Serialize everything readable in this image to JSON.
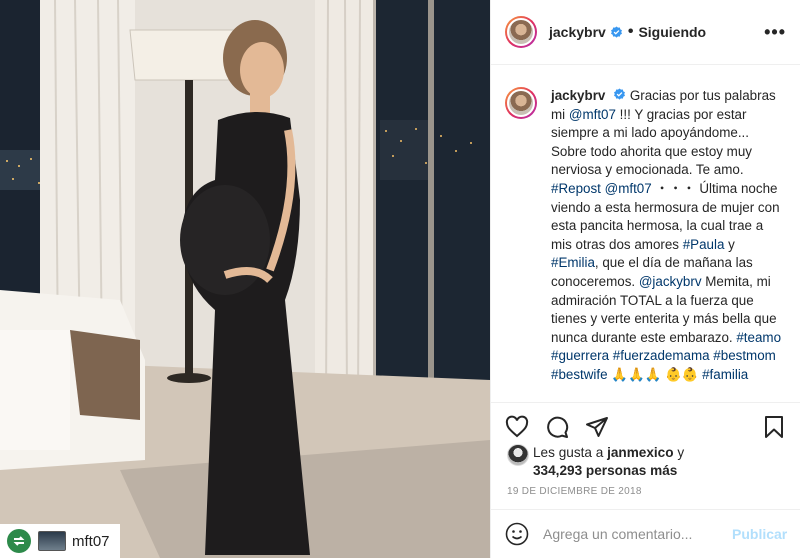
{
  "post": {
    "photo_description_icon": "photo",
    "repost_badge_username": "mft07"
  },
  "header": {
    "username": "jackybrv",
    "separator": "•",
    "follow_label": "Siguiendo",
    "more_icon": "more-dots",
    "more_label": "•••"
  },
  "caption": {
    "username": "jackybrv",
    "segments": [
      {
        "text": "Gracias por tus palabras mi ",
        "tag": false
      },
      {
        "text": "@mft07",
        "tag": true
      },
      {
        "text": " !!! Y gracias por estar siempre a mi lado apoyándome... Sobre todo ahorita que estoy muy nerviosa y emocionada. Te amo. ",
        "tag": false
      },
      {
        "text": "#Repost",
        "tag": true
      },
      {
        "text": " ",
        "tag": false
      },
      {
        "text": "@mft07",
        "tag": true
      },
      {
        "text": " ・・・ Última noche viendo a esta hermosura de mujer con esta pancita hermosa, la cual trae a mis otras dos amores ",
        "tag": false
      },
      {
        "text": "#Paula",
        "tag": true
      },
      {
        "text": " y ",
        "tag": false
      },
      {
        "text": "#Emilia",
        "tag": true
      },
      {
        "text": ", que el día de mañana las conoceremos. ",
        "tag": false
      },
      {
        "text": "@jackybrv",
        "tag": true
      },
      {
        "text": " Memita, mi admiración TOTAL a la fuerza que tienes y verte enterita y más bella que nunca durante este embarazo. ",
        "tag": false
      },
      {
        "text": "#teamo",
        "tag": true
      },
      {
        "text": " ",
        "tag": false
      },
      {
        "text": "#guerrera",
        "tag": true
      },
      {
        "text": " ",
        "tag": false
      },
      {
        "text": "#fuerzademama",
        "tag": true
      },
      {
        "text": " ",
        "tag": false
      },
      {
        "text": "#bestmom",
        "tag": true
      },
      {
        "text": " ",
        "tag": false
      },
      {
        "text": "#bestwife",
        "tag": true
      },
      {
        "text": " 🙏🙏🙏 👶👶 ",
        "tag": false
      },
      {
        "text": "#familia",
        "tag": true
      }
    ]
  },
  "actions": {
    "like_icon": "heart-icon",
    "comment_icon": "comment-icon",
    "share_icon": "share-icon",
    "save_icon": "bookmark-icon"
  },
  "likes": {
    "prefix": "Les gusta a ",
    "user": "janmexico",
    "middle": " y ",
    "count": "334,293 personas más"
  },
  "date": "19 de diciembre de 2018",
  "composer": {
    "placeholder": "Agrega un comentario...",
    "publish_label": "Publicar"
  },
  "colors": {
    "link": "#00376b",
    "publish_disabled": "#b2dffc",
    "verified": "#3897f0",
    "muted": "#8e8e8e"
  }
}
